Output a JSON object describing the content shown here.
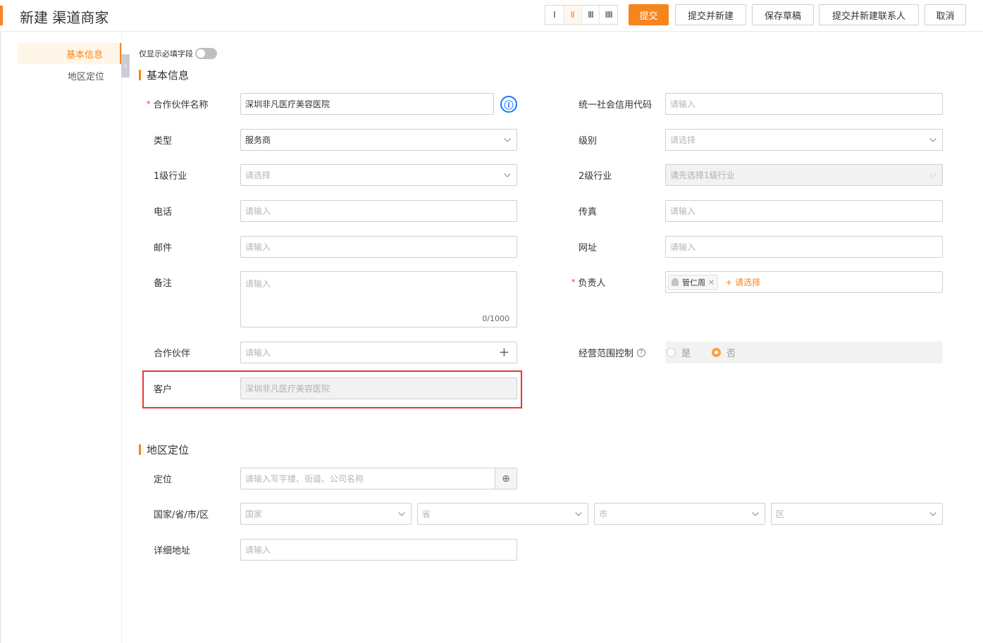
{
  "header": {
    "title": "新建 渠道商家",
    "layout_options": [
      "I",
      "II",
      "III",
      "IIII"
    ],
    "buttons": {
      "submit": "提交",
      "submit_new": "提交并新建",
      "save_draft": "保存草稿",
      "submit_new_contact": "提交并新建联系人",
      "cancel": "取消"
    }
  },
  "sidebar": {
    "items": [
      "基本信息",
      "地区定位"
    ],
    "collapse_glyph": "‹"
  },
  "toggle_label": "仅显示必填字段",
  "sections": {
    "basic": "基本信息",
    "region": "地区定位"
  },
  "form": {
    "partner_name": {
      "label": "合作伙伴名称",
      "value": "深圳非凡医疗美容医院",
      "required": "*"
    },
    "credit_code": {
      "label": "统一社会信用代码",
      "placeholder": "请输入"
    },
    "type": {
      "label": "类型",
      "value": "服务商"
    },
    "level": {
      "label": "级别",
      "placeholder": "请选择"
    },
    "industry1": {
      "label": "1级行业",
      "placeholder": "请选择"
    },
    "industry2": {
      "label": "2级行业",
      "placeholder": "请先选择1级行业"
    },
    "phone": {
      "label": "电话",
      "placeholder": "请输入"
    },
    "fax": {
      "label": "传真",
      "placeholder": "请输入"
    },
    "email": {
      "label": "邮件",
      "placeholder": "请输入"
    },
    "website": {
      "label": "网址",
      "placeholder": "请输入"
    },
    "remark": {
      "label": "备注",
      "placeholder": "请输入",
      "counter": "0/1000"
    },
    "owner": {
      "label": "负责人",
      "required": "*",
      "tag": "管仁周",
      "tag_close": "×",
      "add": "+ 请选择"
    },
    "partner": {
      "label": "合作伙伴",
      "placeholder": "请输入",
      "plus": "+"
    },
    "scope": {
      "label": "经营范围控制",
      "yes": "是",
      "no": "否"
    },
    "customer": {
      "label": "客户",
      "value": "深圳非凡医疗美容医院"
    },
    "location": {
      "label": "定位",
      "placeholder": "请输入写字楼、街道、公司名称"
    },
    "region": {
      "label": "国家/省/市/区",
      "country": "国家",
      "province": "省",
      "city": "市",
      "district": "区"
    },
    "address": {
      "label": "详细地址",
      "placeholder": "请输入"
    }
  },
  "icons": {
    "partner_info": "Ⓘ",
    "help": "?",
    "locate": "⊕"
  },
  "colors": {
    "accent": "#f7851e",
    "link": "#1677ff",
    "highlight": "#e53935"
  }
}
